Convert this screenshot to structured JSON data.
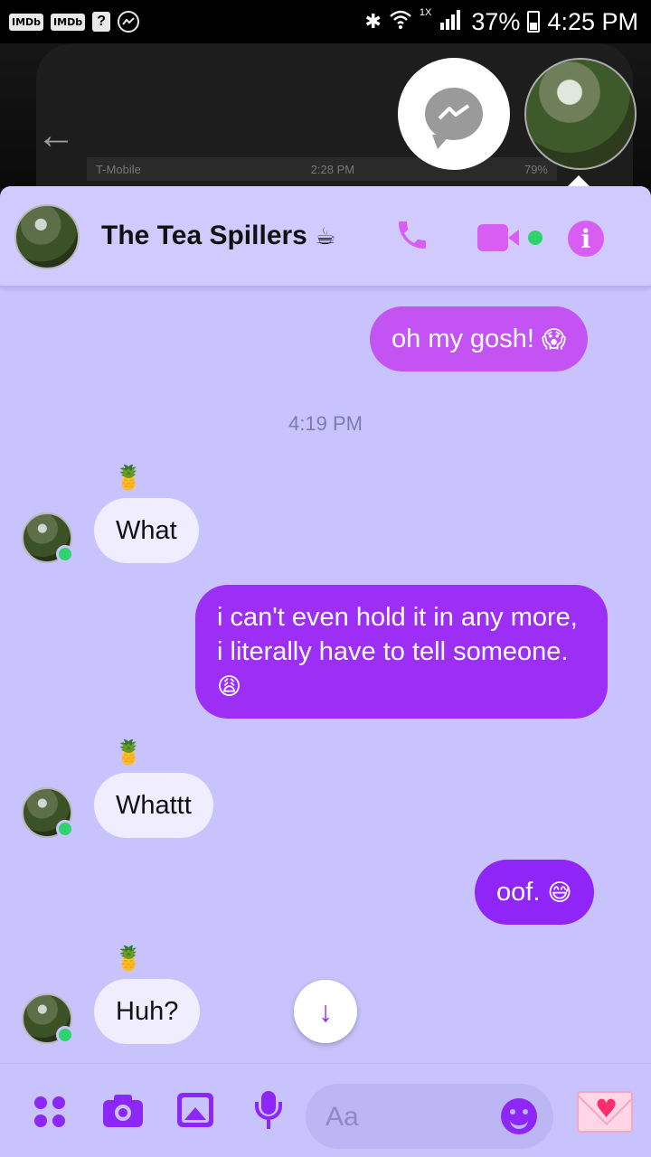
{
  "status_bar": {
    "left_icons": [
      "imdb-icon",
      "imdb-icon",
      "question-app-icon",
      "messenger-icon"
    ],
    "imdb_label": "IMDb",
    "question_label": "?",
    "bluetooth": "bluetooth-icon",
    "wifi": "wifi-icon",
    "wifi_rate": "1X",
    "signal": "signal-icon",
    "battery_percent": "37%",
    "time": "4:25 PM"
  },
  "background_screen": {
    "carrier": "T-Mobile",
    "time": "2:28 PM",
    "battery": "79%"
  },
  "header": {
    "title": "The Tea Spillers",
    "title_emoji": "☕",
    "icons": [
      "phone-icon",
      "video-camera-icon",
      "info-icon"
    ]
  },
  "messages": {
    "m1": {
      "text": "oh my gosh!",
      "emoji": "😱",
      "side": "outgoing"
    },
    "timestamp": "4:19 PM",
    "r1_reaction": "🍍",
    "r1": {
      "text": "What",
      "side": "incoming"
    },
    "m2": {
      "text": "i can't even hold it in any more, i literally have to tell someone.",
      "emoji": "😩",
      "side": "outgoing"
    },
    "r2_reaction": "🍍",
    "r2": {
      "text": "Whattt",
      "side": "incoming"
    },
    "m3": {
      "text": "oof.",
      "emoji": "😅",
      "side": "outgoing"
    },
    "r3_reaction": "🍍",
    "r3": {
      "text": "Huh?",
      "side": "incoming"
    }
  },
  "composer": {
    "placeholder": "Aa",
    "icons": [
      "apps-grid-icon",
      "camera-icon",
      "gallery-icon",
      "microphone-icon",
      "emoji-icon",
      "love-letter-icon"
    ]
  },
  "colors": {
    "panel_bg": "#c9c3fd",
    "accent": "#8d27f7",
    "header_icons": "#d85df3",
    "outgoing_1": "#c353f3",
    "outgoing_2": "#9d2ef6",
    "incoming_bg": "#efedff"
  }
}
